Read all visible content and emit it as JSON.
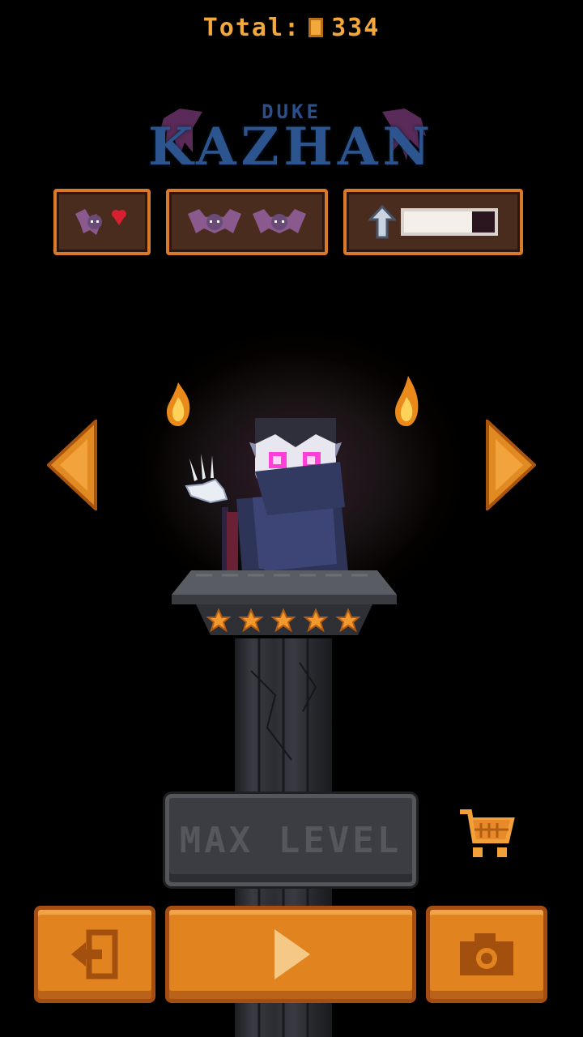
{
  "total": {
    "label": "Total:",
    "value": "334",
    "coin_icon": "coin-icon"
  },
  "title": {
    "top": "DUKE",
    "main": "KAZHAN"
  },
  "stats": {
    "lives_icon": "bat-heart-icon",
    "bats_icons": [
      "bat-icon",
      "bat-icon"
    ],
    "upgrade_icon": "up-arrow-icon",
    "upgrade_progress": 0.75
  },
  "nav": {
    "prev_icon": "left-arrow-icon",
    "next_icon": "right-arrow-icon"
  },
  "character": {
    "stars": 5
  },
  "max_level_label": "MAX LEVEL",
  "cart_icon": "shopping-cart-icon",
  "bottom": {
    "exit_icon": "exit-icon",
    "play_icon": "play-icon",
    "camera_icon": "camera-icon"
  },
  "colors": {
    "accent": "#e1841f",
    "gold": "#f2a83a",
    "title_blue": "#2c558f",
    "panel_border": "#d9792a"
  }
}
